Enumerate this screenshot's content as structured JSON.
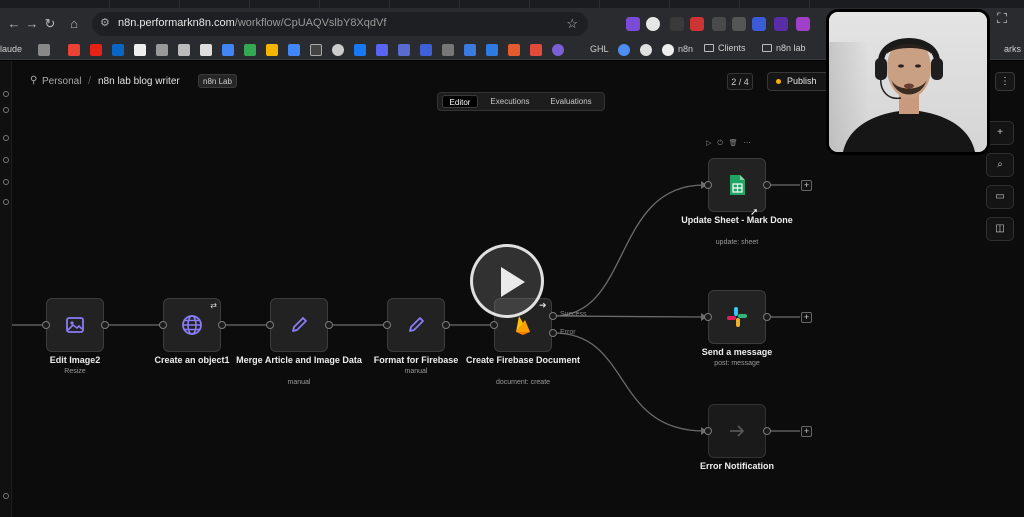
{
  "browser": {
    "url_host": "n8n.performarkn8n.com",
    "url_path": "/workflow/CpUAQVslbY8XqdVf",
    "bookmarks": {
      "first_label": "laude",
      "text_items": [
        "GHL",
        "n8n"
      ],
      "folders": [
        "Clients",
        "n8n lab",
        "arks"
      ]
    }
  },
  "header": {
    "breadcrumb_project": "Personal",
    "breadcrumb_separator": "/",
    "workflow_name": "n8n lab blog writer",
    "tag": "n8n Lab",
    "page_counter": "2 / 4",
    "publish_label": "Publish",
    "more_label": "⋮",
    "tabs": [
      {
        "label": "Editor",
        "active": true
      },
      {
        "label": "Executions",
        "active": false
      },
      {
        "label": "Evaluations",
        "active": false
      }
    ]
  },
  "nodes": [
    {
      "id": "edit-image2",
      "label": "Edit Image2",
      "subtitle": "Resize",
      "icon": "image-icon"
    },
    {
      "id": "create-object1",
      "label": "Create an object1",
      "subtitle": "",
      "icon": "globe-icon"
    },
    {
      "id": "merge-article",
      "label": "Merge Article and Image Data",
      "subtitle": "manual",
      "icon": "pencil-icon"
    },
    {
      "id": "format-firebase",
      "label": "Format for Firebase",
      "subtitle": "manual",
      "icon": "pencil-icon"
    },
    {
      "id": "create-firebase-doc",
      "label": "Create Firebase Document",
      "subtitle": "document: create",
      "icon": "firebase-icon"
    },
    {
      "id": "update-sheet",
      "label": "Update Sheet - Mark Done",
      "subtitle": "update: sheet",
      "icon": "google-sheets-icon"
    },
    {
      "id": "send-message",
      "label": "Send a message",
      "subtitle": "post: message",
      "icon": "slack-icon"
    },
    {
      "id": "error-notification",
      "label": "Error Notification",
      "subtitle": "",
      "icon": "arrow-right-icon"
    }
  ],
  "wire_labels": {
    "success": "Success",
    "error": "Error"
  },
  "node_toolbar": "▷ ⏻ 🗑 ⋯",
  "colors": {
    "publish_dot": "#f5b301",
    "node_icon_purple": "#8a7cf6",
    "sheets_green": "#1fa463",
    "firebase_orange": "#ffa000"
  }
}
